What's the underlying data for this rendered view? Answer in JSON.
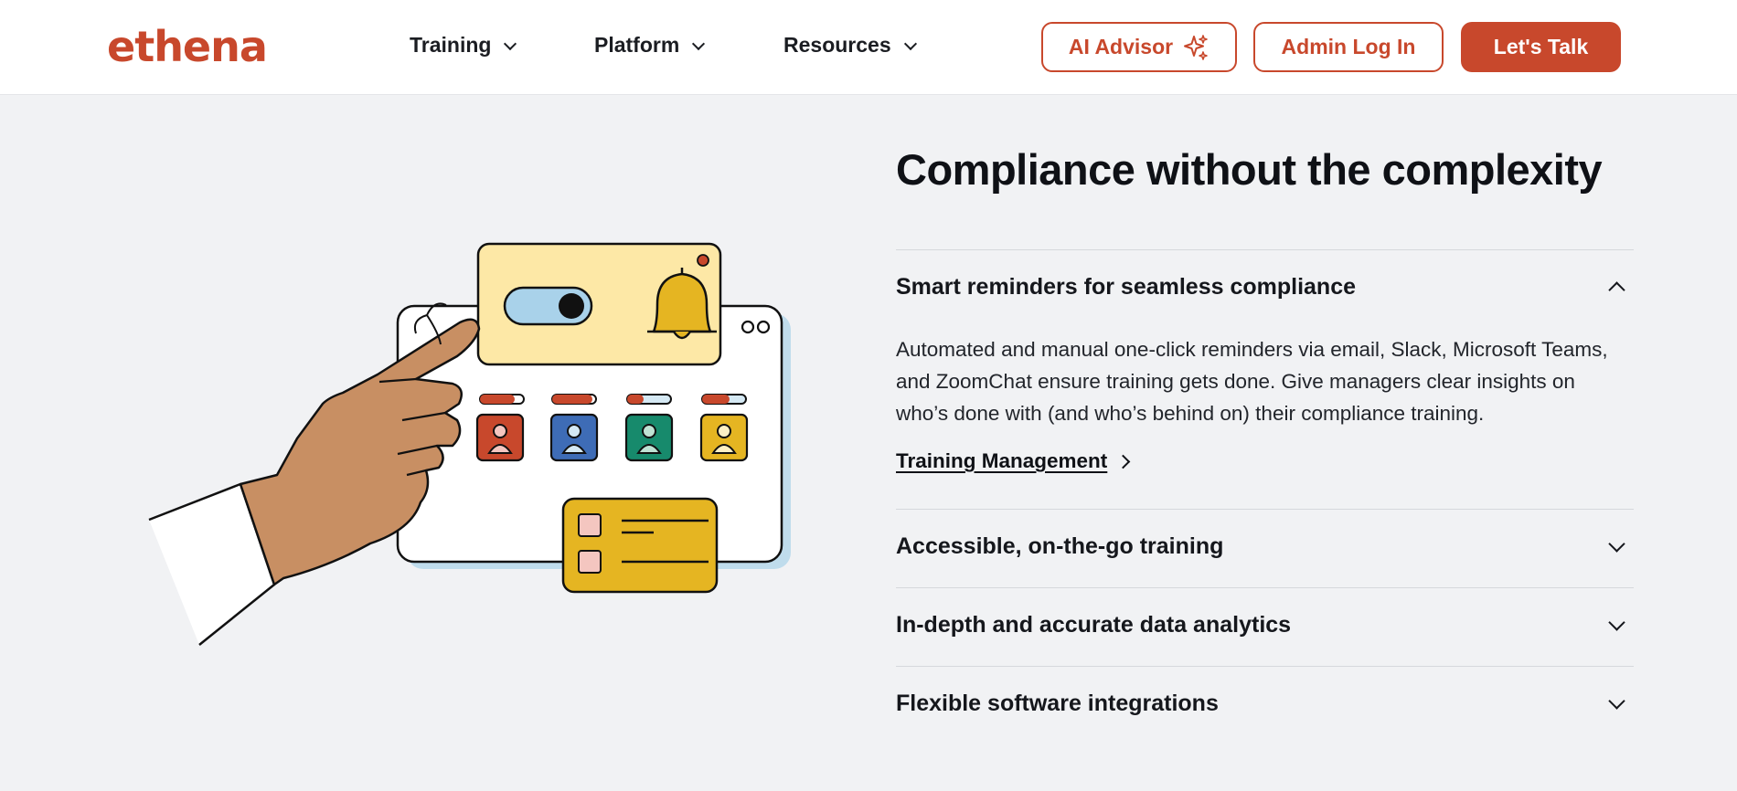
{
  "header": {
    "logo": "ethena",
    "nav": [
      {
        "label": "Training"
      },
      {
        "label": "Platform"
      },
      {
        "label": "Resources"
      }
    ],
    "ai_advisor_label": "AI Advisor",
    "admin_login_label": "Admin Log In",
    "lets_talk_label": "Let's Talk"
  },
  "main": {
    "title": "Compliance without the complexity",
    "accordion": [
      {
        "title": "Smart reminders for seamless compliance",
        "expanded": true,
        "body": "Automated and manual one-click reminders via email, Slack, Microsoft Teams, and ZoomChat ensure training gets done. Give managers clear insights on who’s done with (and who’s behind on) their compliance training.",
        "link": "Training Management"
      },
      {
        "title": "Accessible, on-the-go training",
        "expanded": false
      },
      {
        "title": "In-depth and accurate data analytics",
        "expanded": false
      },
      {
        "title": "Flexible software integrations",
        "expanded": false
      }
    ]
  },
  "colors": {
    "brand": "#c8482c",
    "background": "#f1f2f4",
    "header_bg": "#ffffff"
  }
}
